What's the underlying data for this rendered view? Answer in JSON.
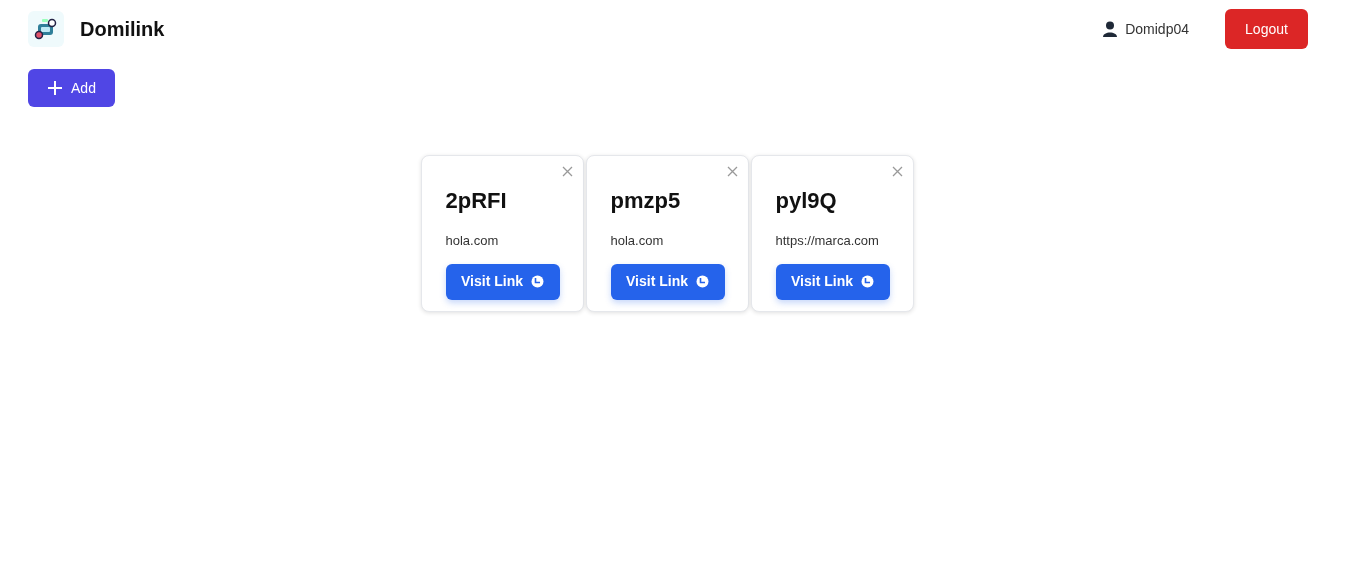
{
  "header": {
    "brand": "Domilink",
    "user": "Domidp04",
    "logout": "Logout"
  },
  "add_button": "Add",
  "links": [
    {
      "title": "2pRFI",
      "url": "hola.com",
      "button": "Visit Link"
    },
    {
      "title": "pmzp5",
      "url": "hola.com",
      "button": "Visit Link"
    },
    {
      "title": "pyl9Q",
      "url": "https://marca.com",
      "button": "Visit Link"
    }
  ]
}
